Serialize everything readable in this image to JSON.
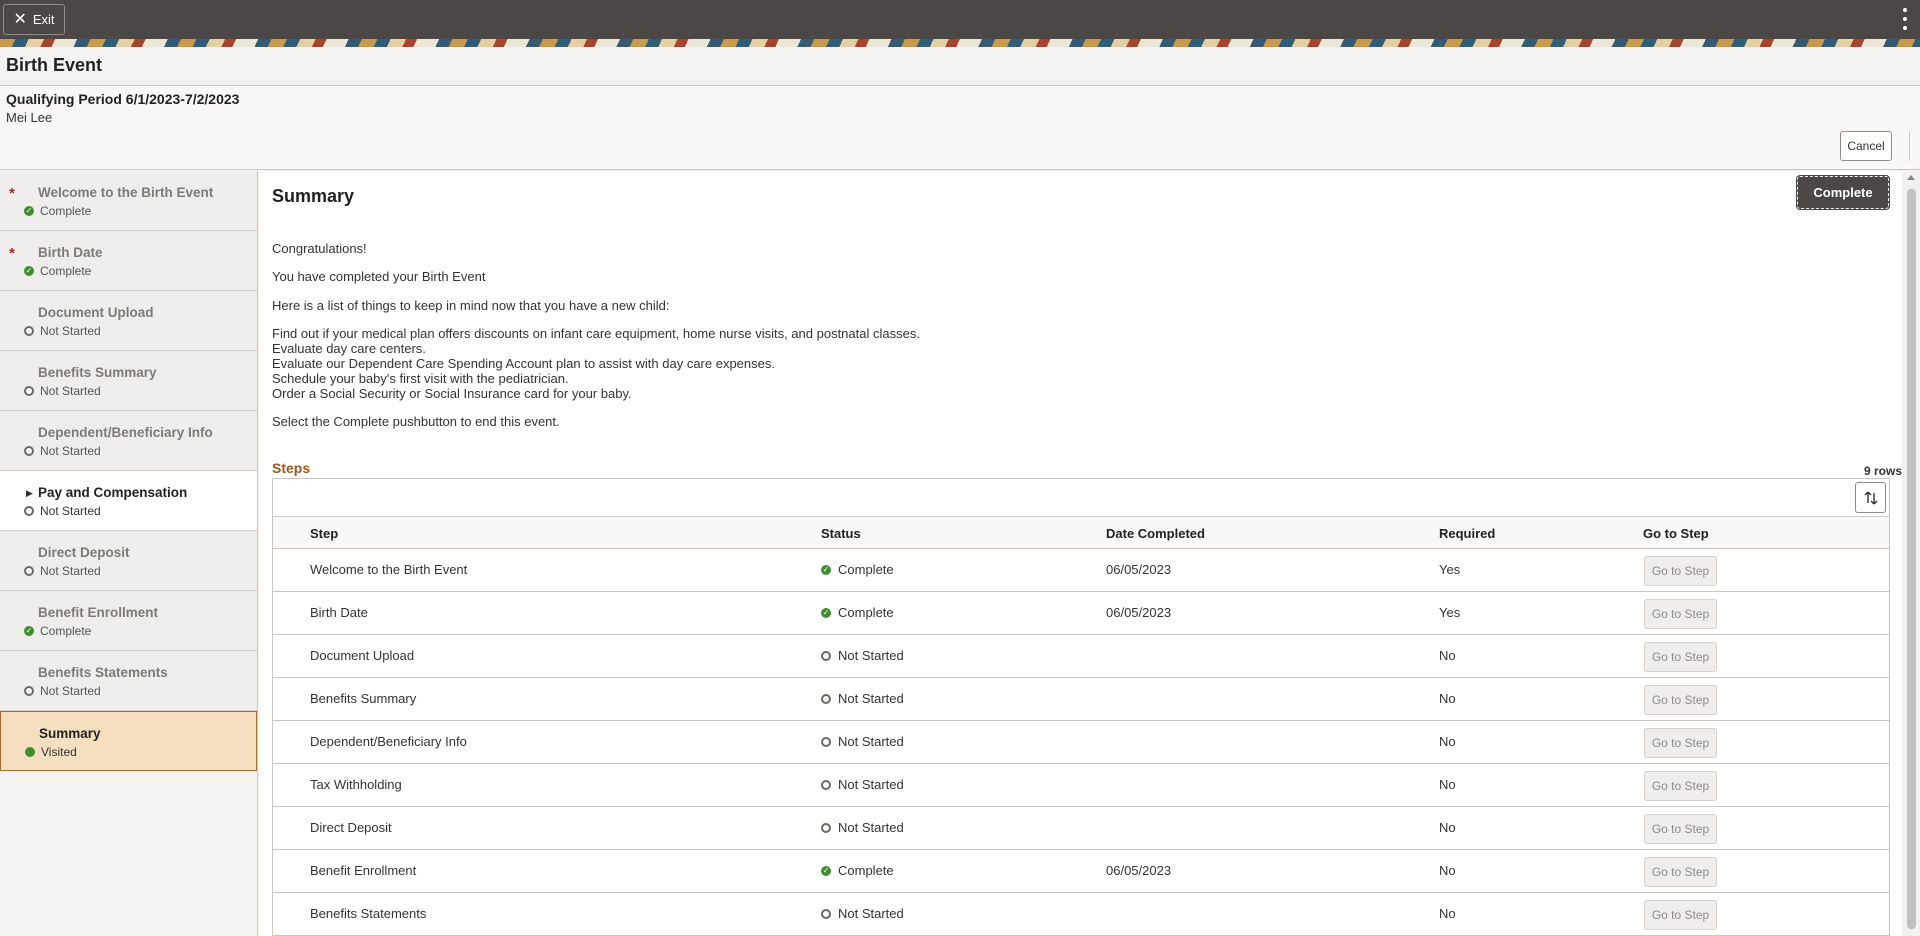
{
  "topbar": {
    "exit_label": "Exit"
  },
  "page": {
    "title": "Birth Event",
    "period": "Qualifying Period 6/1/2023-7/2/2023",
    "person": "Mei Lee",
    "cancel_label": "Cancel"
  },
  "sidebar": {
    "items": [
      {
        "label": "Welcome to the Birth Event",
        "status": "Complete",
        "required": "*"
      },
      {
        "label": "Birth Date",
        "status": "Complete",
        "required": "*"
      },
      {
        "label": "Document Upload",
        "status": "Not Started"
      },
      {
        "label": "Benefits Summary",
        "status": "Not Started"
      },
      {
        "label": "Dependent/Beneficiary Info",
        "status": "Not Started"
      },
      {
        "label": "Pay and Compensation",
        "status": "Not Started"
      },
      {
        "label": "Direct Deposit",
        "status": "Not Started"
      },
      {
        "label": "Benefit Enrollment",
        "status": "Complete"
      },
      {
        "label": "Benefits Statements",
        "status": "Not Started"
      },
      {
        "label": "Summary",
        "status": "Visited"
      }
    ]
  },
  "main": {
    "title": "Summary",
    "complete_label": "Complete",
    "messages": {
      "congrats": "Congratulations!",
      "completed": "You have completed your Birth Event",
      "list_intro": "Here is a list of things to keep in mind now that you have a new child:",
      "tips": [
        "Find out if your medical plan offers discounts on infant care equipment, home nurse visits, and postnatal classes.",
        "Evaluate day care centers.",
        "Evaluate our Dependent Care Spending Account plan to assist with day care expenses.",
        "Schedule your baby's first visit with the pediatrician.",
        "Order a Social Security or Social Insurance card for your baby."
      ],
      "select_complete": "Select the Complete pushbutton to end this event."
    },
    "steps": {
      "title": "Steps",
      "row_count": "9 rows",
      "columns": [
        "Step",
        "Status",
        "Date Completed",
        "Required",
        "Go to Step"
      ],
      "goto_label": "Go to Step",
      "rows": [
        {
          "step": "Welcome to the Birth Event",
          "status": "Complete",
          "date": "06/05/2023",
          "required": "Yes"
        },
        {
          "step": "Birth Date",
          "status": "Complete",
          "date": "06/05/2023",
          "required": "Yes"
        },
        {
          "step": "Document Upload",
          "status": "Not Started",
          "date": "",
          "required": "No"
        },
        {
          "step": "Benefits Summary",
          "status": "Not Started",
          "date": "",
          "required": "No"
        },
        {
          "step": "Dependent/Beneficiary Info",
          "status": "Not Started",
          "date": "",
          "required": "No"
        },
        {
          "step": "Tax Withholding",
          "status": "Not Started",
          "date": "",
          "required": "No"
        },
        {
          "step": "Direct Deposit",
          "status": "Not Started",
          "date": "",
          "required": "No"
        },
        {
          "step": "Benefit Enrollment",
          "status": "Complete",
          "date": "06/05/2023",
          "required": "No"
        },
        {
          "step": "Benefits Statements",
          "status": "Not Started",
          "date": "",
          "required": "No"
        }
      ]
    }
  },
  "colors": {
    "accent": "#4a4746",
    "complete": "#3f8f2e",
    "selected_bg": "#f6dfbe",
    "required": "#a12d22",
    "steps_title": "#9a5a1e"
  }
}
